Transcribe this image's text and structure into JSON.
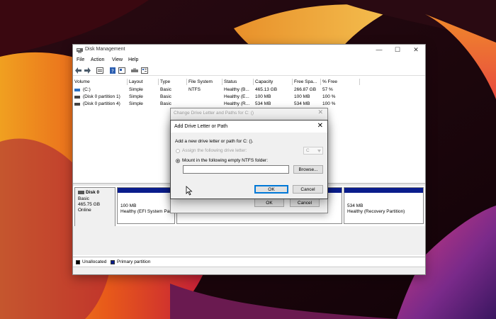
{
  "window": {
    "title": "Disk Management",
    "controls": [
      "—",
      "☐",
      "✕"
    ]
  },
  "menu": [
    "File",
    "Action",
    "View",
    "Help"
  ],
  "toolbar_icons": [
    "back-icon",
    "forward-icon",
    "properties-icon",
    "help-icon",
    "rescan-icon",
    "disk-icon",
    "list-icon"
  ],
  "volumes": {
    "headers": [
      "Volume",
      "Layout",
      "Type",
      "File System",
      "Status",
      "Capacity",
      "Free Spa...",
      "% Free"
    ],
    "rows": [
      [
        "(C:)",
        "Simple",
        "Basic",
        "NTFS",
        "Healthy (B...",
        "465.13 GB",
        "266.87 GB",
        "57 %"
      ],
      [
        "(Disk 0 partition 1)",
        "Simple",
        "Basic",
        "",
        "Healthy (E...",
        "100 MB",
        "100 MB",
        "100 %"
      ],
      [
        "(Disk 0 partition 4)",
        "Simple",
        "Basic",
        "",
        "Healthy (R...",
        "534 MB",
        "534 MB",
        "100 %"
      ]
    ]
  },
  "disk": {
    "name": "Disk 0",
    "type": "Basic",
    "size": "465.75 GB",
    "state": "Online",
    "partitions": [
      {
        "size": "100 MB",
        "status": "Healthy (EFI System Par"
      },
      {
        "size": "534 MB",
        "status": "Healthy (Recovery Partition)"
      }
    ]
  },
  "legend": [
    {
      "label": "Unallocated",
      "color": "#000000"
    },
    {
      "label": "Primary partition",
      "color": "#0a1d8c"
    }
  ],
  "bg_dialog": {
    "title": "Change Drive Letter and Paths for C: ()",
    "ok": "OK",
    "cancel": "Cancel"
  },
  "fg_dialog": {
    "title": "Add Drive Letter or Path",
    "instruction": "Add a new drive letter or path for C: ().",
    "option_assign": "Assign the following drive letter:",
    "letter_value": "C",
    "option_mount": "Mount in the following empty NTFS folder:",
    "folder_value": "",
    "browse": "Browse...",
    "ok": "OK",
    "cancel": "Cancel"
  },
  "colors": {
    "primary_partition": "#0a1d8c",
    "accent": "#0078d7"
  }
}
